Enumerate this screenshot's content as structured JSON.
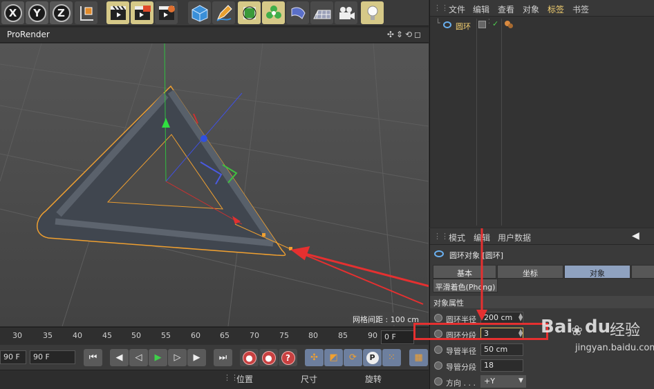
{
  "toolbar": {
    "axis_x": "X",
    "axis_y": "Y",
    "axis_z": "Z"
  },
  "viewport": {
    "title": "ProRender",
    "nav_glyphs": "✣⇕⟲◻",
    "grid_label": "网格间距 : 100 cm"
  },
  "timeline": {
    "ticks": [
      "30",
      "35",
      "40",
      "45",
      "50",
      "55",
      "60",
      "65",
      "70",
      "75",
      "80",
      "85",
      "90"
    ],
    "current_frame": "0 F"
  },
  "playback": {
    "start_field": "90 F",
    "end_field": "90 F",
    "btn_key": "P"
  },
  "coords": {
    "position": "位置",
    "size": "尺寸",
    "rotation": "旋转"
  },
  "object_manager": {
    "menu": [
      "文件",
      "编辑",
      "查看",
      "对象",
      "标签",
      "书签"
    ],
    "object_name": "圆环",
    "object_checkmark": "✓"
  },
  "attribute_manager": {
    "menu": [
      "模式",
      "编辑",
      "用户数据"
    ],
    "header": "圆环对象 [圆环]",
    "tabs": [
      "基本",
      "坐标",
      "对象"
    ],
    "active_tab": "对象",
    "phong_tab": "平滑着色(Phong)",
    "section": "对象属性",
    "props": [
      {
        "label": "圆环半径",
        "value": "200 cm"
      },
      {
        "label": "圆环分段",
        "value": "3"
      },
      {
        "label": "导管半径",
        "value": "50 cm"
      },
      {
        "label": "导管分段",
        "value": "18"
      },
      {
        "label": "方向 . . .",
        "value": "+Y"
      }
    ]
  },
  "watermark": {
    "brand": "Bai",
    "brand2": "du",
    "cn": "经验",
    "url": "jingyan.baidu.com"
  },
  "colors": {
    "highlight": "#d6c988",
    "active_tab": "#8fa2c0",
    "annotation_red": "#e53030",
    "selection_orange": "#f0a030"
  }
}
